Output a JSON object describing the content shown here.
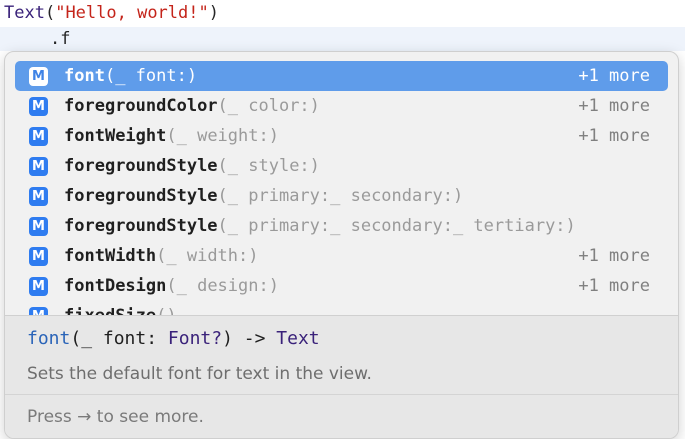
{
  "editor": {
    "line1": {
      "type_name": "Text",
      "open_paren": "(",
      "string": "\"Hello, world!\"",
      "close_paren": ")"
    },
    "line2": ".f"
  },
  "completion": {
    "kind_badge": "M",
    "items": [
      {
        "match": "f",
        "rest": "ont",
        "args": "(_ font:)",
        "more": "+1 more",
        "selected": true
      },
      {
        "match": "f",
        "rest": "oregroundColor",
        "args": "(_ color:)",
        "more": "+1 more",
        "selected": false
      },
      {
        "match": "f",
        "rest": "ontWeight",
        "args": "(_ weight:)",
        "more": "+1 more",
        "selected": false
      },
      {
        "match": "f",
        "rest": "oregroundStyle",
        "args": "(_ style:)",
        "more": "",
        "selected": false
      },
      {
        "match": "f",
        "rest": "oregroundStyle",
        "args": "(_ primary:_ secondary:)",
        "more": "",
        "selected": false
      },
      {
        "match": "f",
        "rest": "oregroundStyle",
        "args": "(_ primary:_ secondary:_ tertiary:)",
        "more": "",
        "selected": false
      },
      {
        "match": "f",
        "rest": "ontWidth",
        "args": "(_ width:)",
        "more": "+1 more",
        "selected": false
      },
      {
        "match": "f",
        "rest": "ontDesign",
        "args": "(_ design:)",
        "more": "+1 more",
        "selected": false
      },
      {
        "match": "f",
        "rest": "ixedSize",
        "args": "()",
        "more": "",
        "selected": false
      }
    ],
    "detail": {
      "decl_fn": "font",
      "decl_params_start": "(_ font: ",
      "decl_param_type": "Font?",
      "decl_params_end": ") -> ",
      "decl_return": "Text",
      "description": "Sets the default font for text in the view.",
      "hint": "Press → to see more."
    }
  },
  "colors": {
    "selection": "#5f9cea",
    "badge": "#2f7cf0",
    "type": "#3a227a",
    "string": "#c4241a"
  }
}
